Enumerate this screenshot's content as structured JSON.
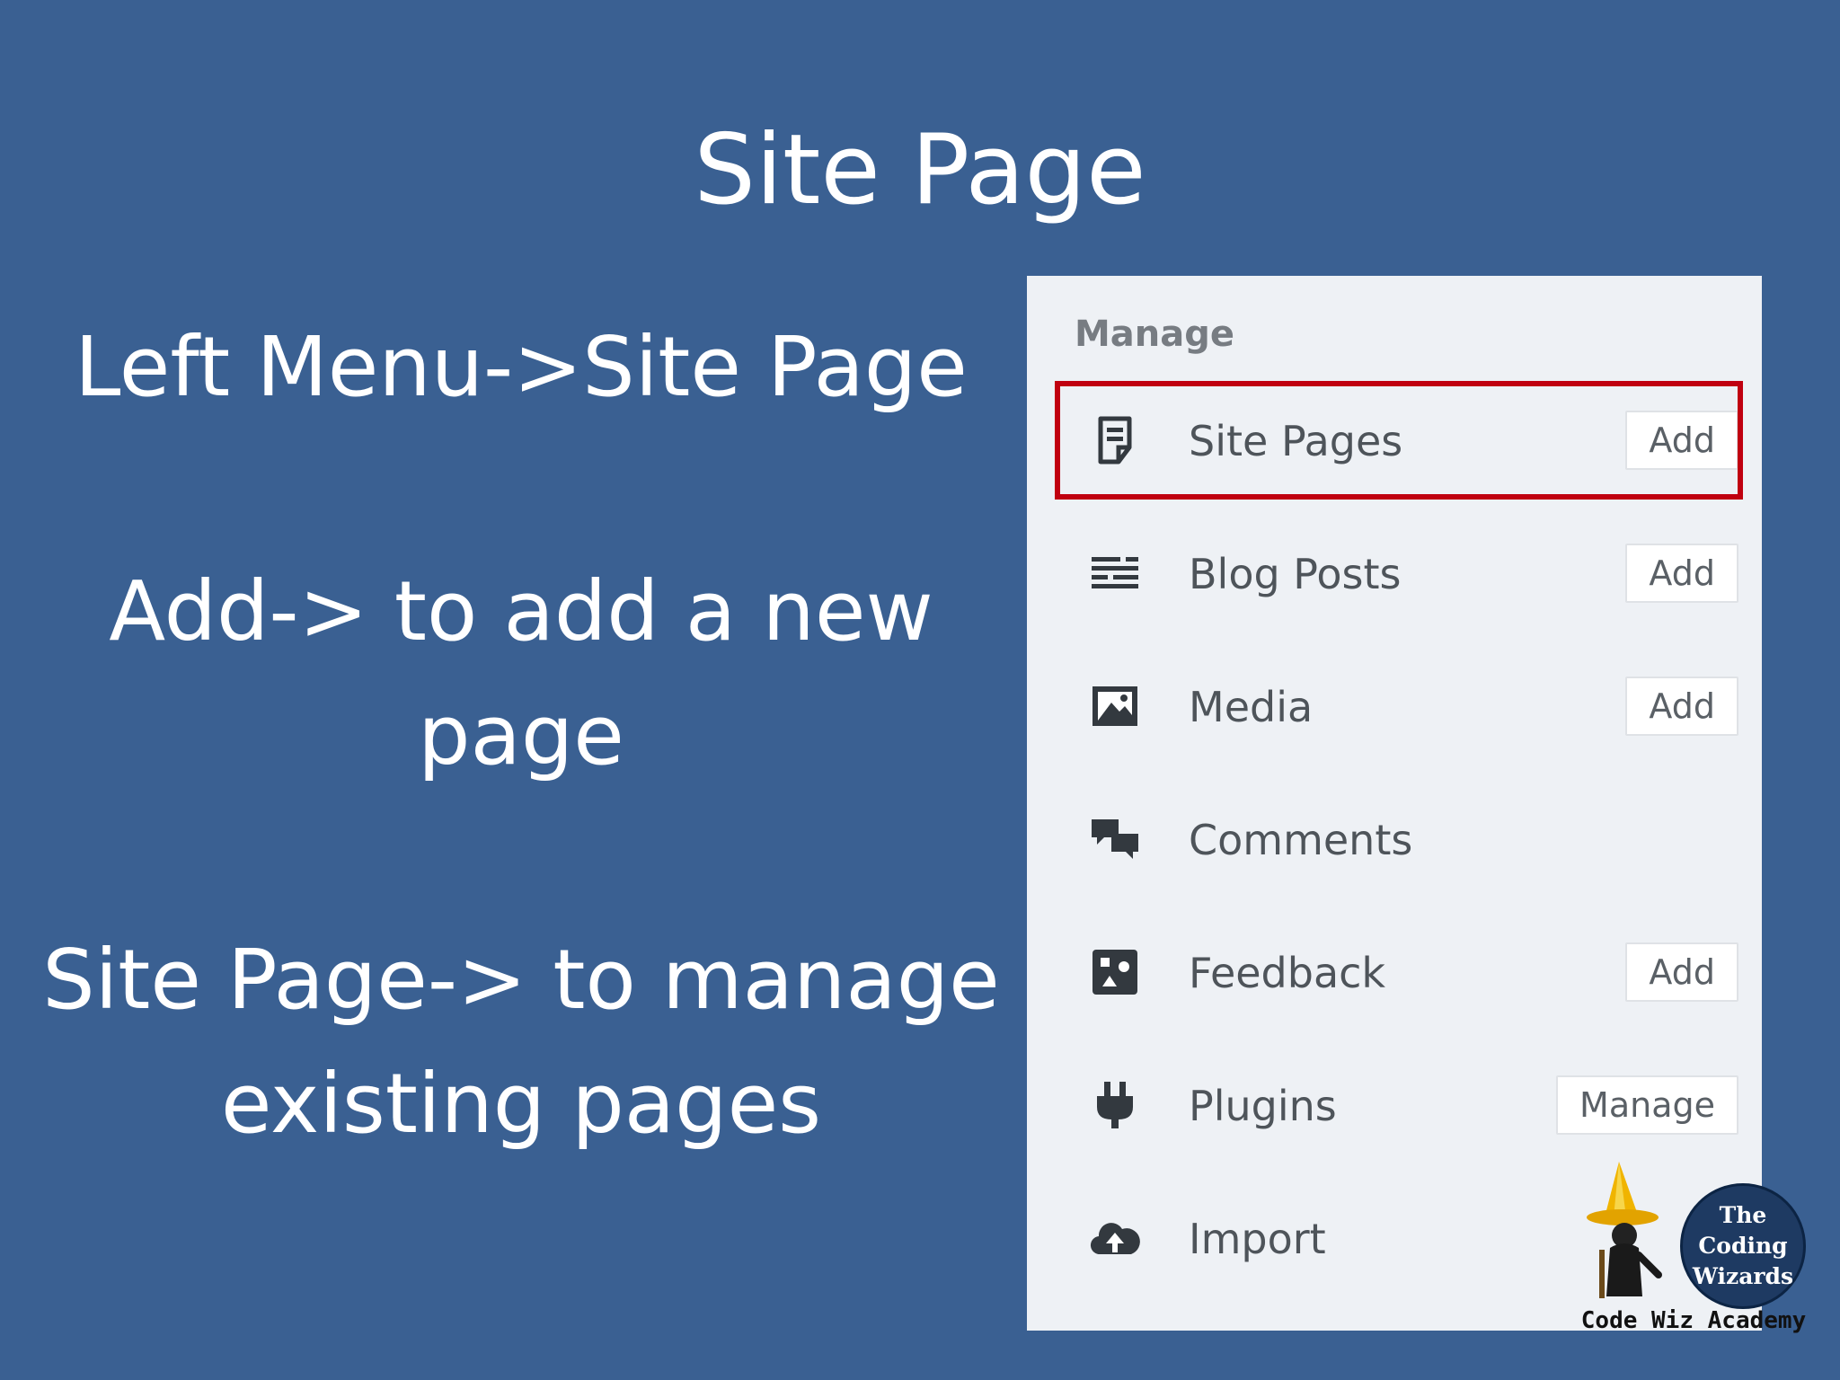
{
  "slide": {
    "title": "Site Page",
    "bullets": [
      "Left Menu->Site Page",
      "Add-> to add a new\npage",
      "Site Page-> to manage\nexisting pages"
    ]
  },
  "panel": {
    "heading": "Manage",
    "items": [
      {
        "label": "Site Pages",
        "icon": "document-icon",
        "button": "Add",
        "highlighted": true
      },
      {
        "label": "Blog Posts",
        "icon": "blog-lines-icon",
        "button": "Add"
      },
      {
        "label": "Media",
        "icon": "image-icon",
        "button": "Add"
      },
      {
        "label": "Comments",
        "icon": "comments-icon",
        "button": ""
      },
      {
        "label": "Feedback",
        "icon": "feedback-icon",
        "button": "Add"
      },
      {
        "label": "Plugins",
        "icon": "plug-icon",
        "button": "Manage"
      },
      {
        "label": "Import",
        "icon": "cloud-upload-icon",
        "button": ""
      }
    ],
    "highlight_color": "#c00010"
  },
  "logo": {
    "circle_lines": [
      "The",
      "Coding",
      "Wizards"
    ],
    "caption": "Code Wiz Academy"
  },
  "colors": {
    "background": "#3a6092",
    "panel_background": "#eef1f5",
    "text_on_blue": "#ffffff",
    "icon": "#33393f"
  }
}
